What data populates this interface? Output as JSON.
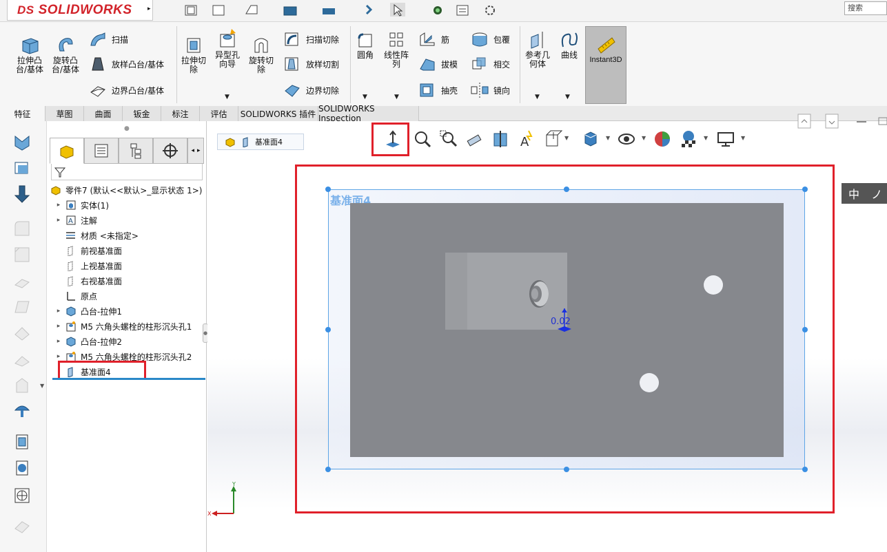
{
  "app": {
    "logo": "SOLIDWORKS",
    "logo_prefix": "DS",
    "search_placeholder": "搜索"
  },
  "ribbon": {
    "extrude_boss": "拉伸凸台/基体",
    "revolve_boss": "旋转凸台/基体",
    "sweep": "扫描",
    "loft_boss": "放样凸台/基体",
    "boundary_boss": "边界凸台/基体",
    "extrude_cut": "拉伸切除",
    "hole_wizard": "异型孔向导",
    "revolve_cut": "旋转切除",
    "sweep_cut": "扫描切除",
    "loft_cut": "放样切割",
    "boundary_cut": "边界切除",
    "fillet": "圆角",
    "linear_pattern": "线性阵列",
    "rib": "筋",
    "wrap": "包覆",
    "draft": "拔模",
    "intersect": "相交",
    "shell": "抽壳",
    "mirror": "镜向",
    "ref_geometry": "参考几何体",
    "curves": "曲线",
    "instant3d": "Instant3D"
  },
  "tabs": [
    {
      "label": "特征",
      "active": true
    },
    {
      "label": "草图",
      "active": false
    },
    {
      "label": "曲面",
      "active": false
    },
    {
      "label": "钣金",
      "active": false
    },
    {
      "label": "标注",
      "active": false
    },
    {
      "label": "评估",
      "active": false
    },
    {
      "label": "SOLIDWORKS 插件",
      "active": false
    },
    {
      "label": "SOLIDWORKS Inspection",
      "active": false
    }
  ],
  "tree": {
    "root": "零件7  (默认<<默认>_显示状态 1>)",
    "nodes": [
      {
        "label": "实体(1)",
        "expandable": true,
        "icon": "solid-bodies-icon"
      },
      {
        "label": "注解",
        "expandable": true,
        "icon": "annotations-icon"
      },
      {
        "label": "材质 <未指定>",
        "expandable": false,
        "icon": "material-icon"
      },
      {
        "label": "前视基准面",
        "expandable": false,
        "icon": "plane-icon"
      },
      {
        "label": "上视基准面",
        "expandable": false,
        "icon": "plane-icon"
      },
      {
        "label": "右视基准面",
        "expandable": false,
        "icon": "plane-icon"
      },
      {
        "label": "原点",
        "expandable": false,
        "icon": "origin-icon"
      },
      {
        "label": "凸台-拉伸1",
        "expandable": true,
        "icon": "boss-extrude-icon"
      },
      {
        "label": "M5 六角头螺栓的柱形沉头孔1",
        "expandable": true,
        "icon": "hole-icon"
      },
      {
        "label": "凸台-拉伸2",
        "expandable": true,
        "icon": "boss-extrude-icon"
      },
      {
        "label": "M5 六角头螺栓的柱形沉头孔2",
        "expandable": true,
        "icon": "hole-icon"
      },
      {
        "label": "基准面4",
        "expandable": false,
        "icon": "plane-icon",
        "selected": true
      }
    ]
  },
  "graphics": {
    "breadcrumb": "基准面4",
    "plane_label": "基准面4",
    "dimension": "0.02",
    "lang_badge": "中 ノ",
    "triad_x": "X",
    "triad_y": "Y"
  },
  "colors": {
    "highlight": "#e0202a",
    "plane_border": "#5da5e6",
    "part": "#86888d",
    "accent_blue": "#2a88c8"
  }
}
